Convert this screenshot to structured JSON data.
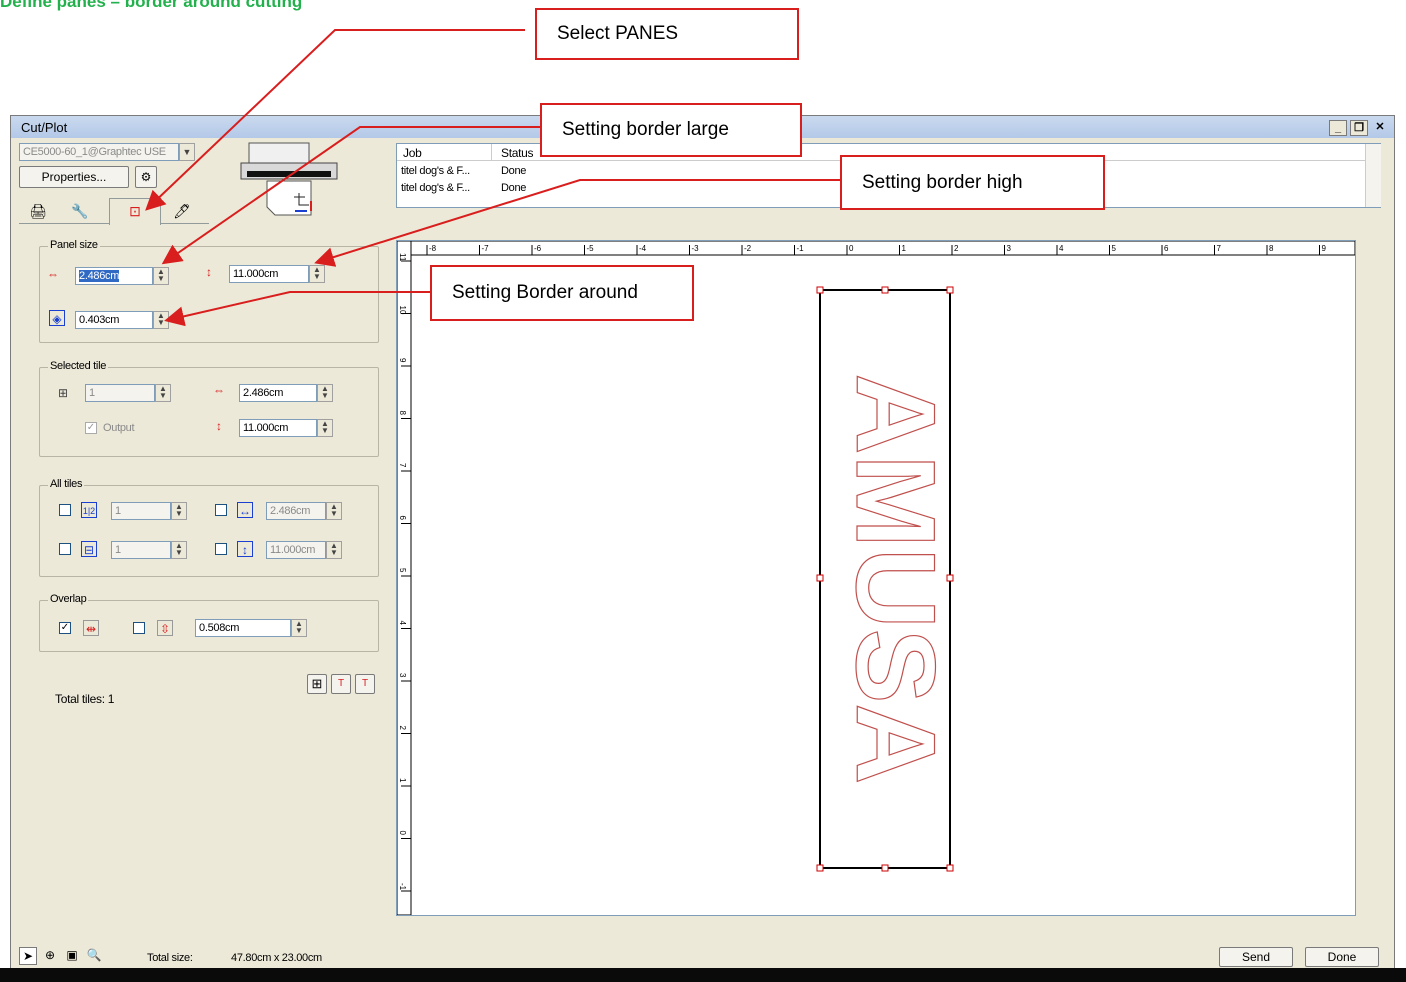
{
  "heading": "Define panes – border around cutting",
  "window": {
    "title": "Cut/Plot"
  },
  "device": {
    "selected": "CE5000-60_1@Graphtec USE",
    "properties_label": "Properties..."
  },
  "jobs": {
    "columns": [
      "Job",
      "Status"
    ],
    "rows": [
      {
        "job": "titel dog's & F...",
        "status": "Done"
      },
      {
        "job": "titel dog's & F...",
        "status": "Done"
      }
    ]
  },
  "panel_size": {
    "label": "Panel size",
    "width": "2.486cm",
    "height": "11.000cm",
    "border": "0.403cm"
  },
  "selected_tile": {
    "label": "Selected tile",
    "index": "1",
    "output_label": "Output",
    "width": "2.486cm",
    "height": "11.000cm"
  },
  "all_tiles": {
    "label": "All tiles",
    "cols": "1",
    "rows": "1",
    "width": "2.486cm",
    "height": "11.000cm"
  },
  "overlap": {
    "label": "Overlap",
    "value": "0.508cm"
  },
  "total_tiles": "Total tiles:  1",
  "status": {
    "label": "Total size:",
    "value": "47.80cm x 23.00cm",
    "send": "Send",
    "done": "Done"
  },
  "ruler": {
    "h": [
      "-8",
      "-7",
      "-6",
      "-5",
      "-4",
      "-3",
      "-2",
      "-1",
      "0",
      "1",
      "2",
      "3",
      "4",
      "5",
      "6",
      "7",
      "8",
      "9"
    ],
    "v": [
      "11",
      "10",
      "9",
      "8",
      "7",
      "6",
      "5",
      "4",
      "3",
      "2",
      "1",
      "0",
      "-1"
    ]
  },
  "canvas_text": "AMUSA",
  "callouts": {
    "select_panes": "Select PANES",
    "border_large": "Setting  border large",
    "border_high": "Setting  border high",
    "border_around": "Setting Border around"
  },
  "colors": {
    "callout": "#d91e1e",
    "heading": "#22b14c",
    "outline": "#c0504d"
  }
}
